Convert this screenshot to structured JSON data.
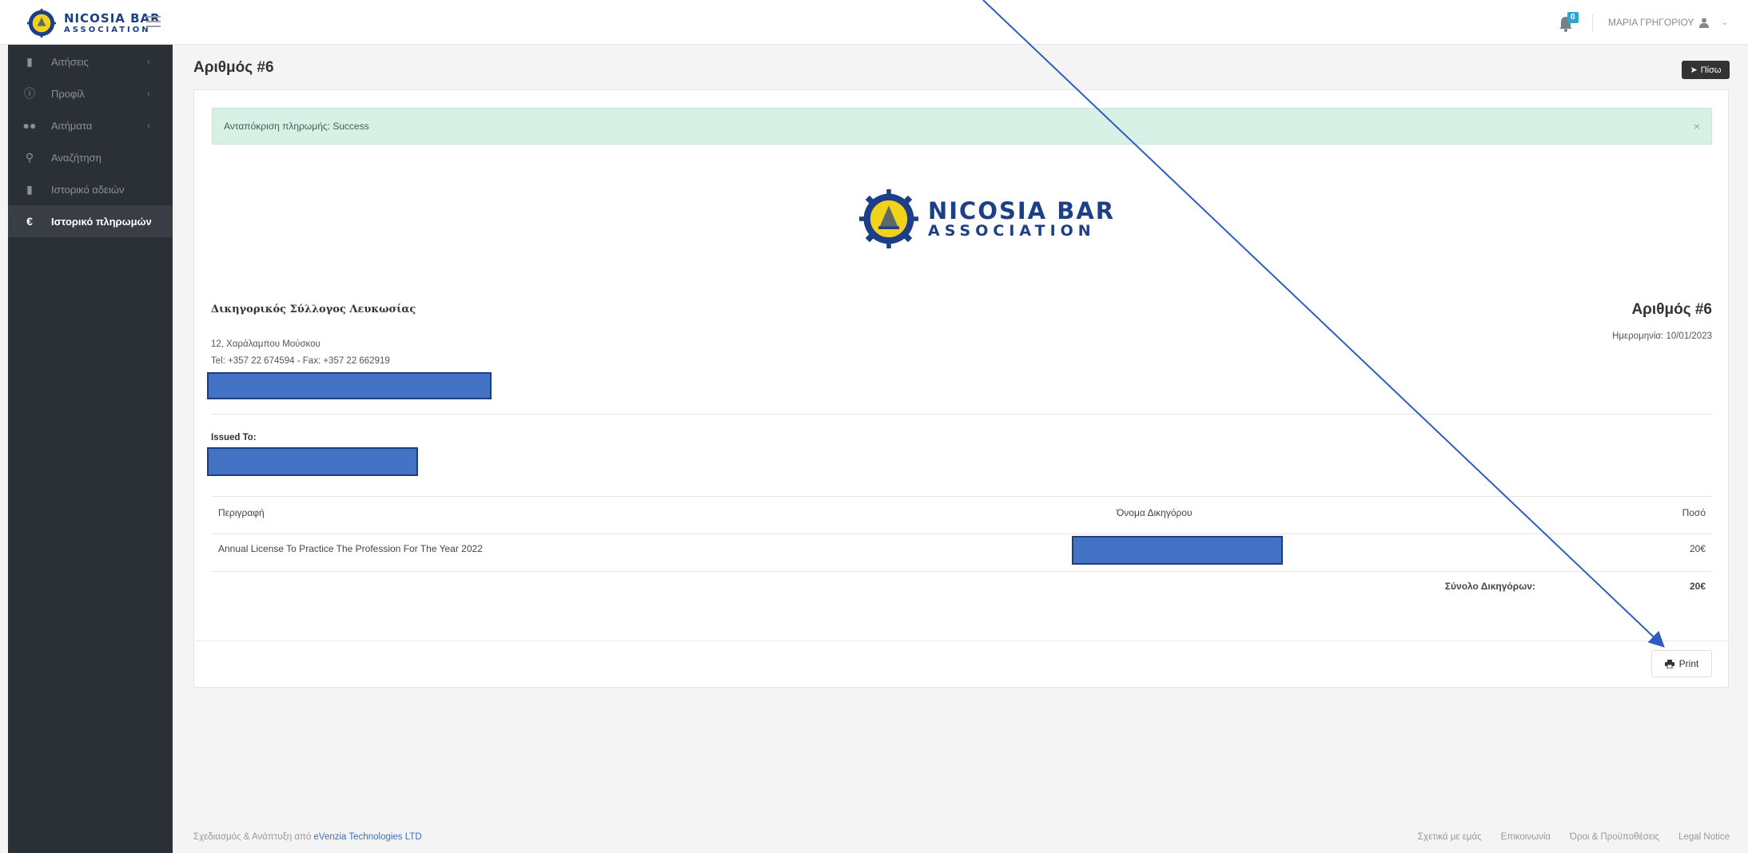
{
  "brand": {
    "line1": "NICOSIA BAR",
    "line2": "ASSOCIATION"
  },
  "header": {
    "notification_count": "0",
    "user_name": "ΜΑΡΙΑ ΓΡΗΓΟΡΙΟΥ"
  },
  "sidebar": {
    "items": [
      {
        "label": "Αιτήσεις",
        "icon": "file-icon",
        "has_submenu": true,
        "active": false
      },
      {
        "label": "Προφίλ",
        "icon": "info-icon",
        "has_submenu": true,
        "active": false
      },
      {
        "label": "Αιτήματα",
        "icon": "users-icon",
        "has_submenu": true,
        "active": false
      },
      {
        "label": "Αναζήτηση",
        "icon": "search-icon",
        "has_submenu": false,
        "active": false
      },
      {
        "label": "Ιστορικό αδειών",
        "icon": "document-icon",
        "has_submenu": false,
        "active": false
      },
      {
        "label": "Ιστορικό πληρωμών",
        "icon": "euro-icon",
        "has_submenu": false,
        "active": true
      }
    ]
  },
  "page": {
    "title": "Αριθμός #6",
    "back_label": "Πίσω"
  },
  "alert": {
    "text": "Ανταπόκριση πληρωμής: Success",
    "color": "#d7f1e6"
  },
  "invoice": {
    "org_name": "Δικηγορικός Σύλλογος Λευκωσίας",
    "address": "12, Χαράλαμπου Μούσκου",
    "contact": "Tel: +357 22 674594 - Fax: +357 22 662919",
    "number": "Αριθμός #6",
    "date": "Ημερομηνία: 10/01/2023",
    "issued_to_label": "Issued To:",
    "table": {
      "headers": {
        "description": "Περιγραφή",
        "lawyer": "Όνομα Δικηγόρου",
        "amount": "Ποσό"
      },
      "rows": [
        {
          "description": "Annual License To Practice The Profession For The Year 2022",
          "amount": "20€"
        }
      ],
      "total_label": "Σύνολο Δικηγόρων:",
      "total_value": "20€"
    },
    "print_label": "Print"
  },
  "footer": {
    "credit_prefix": "Σχεδιασμός & Ανάπτυξη από",
    "credit_link": "eVenzia Technologies LTD",
    "links": [
      "Σχετικά με εμάς",
      "Επικοινωνία",
      "Όροι & Προϋποθέσεις",
      "Legal Notice"
    ]
  },
  "colors": {
    "sidebar": "#2b2f36",
    "brand_blue": "#1d3f87",
    "redaction": "#4472c4",
    "annotation_arrow": "#2f5cc4"
  }
}
